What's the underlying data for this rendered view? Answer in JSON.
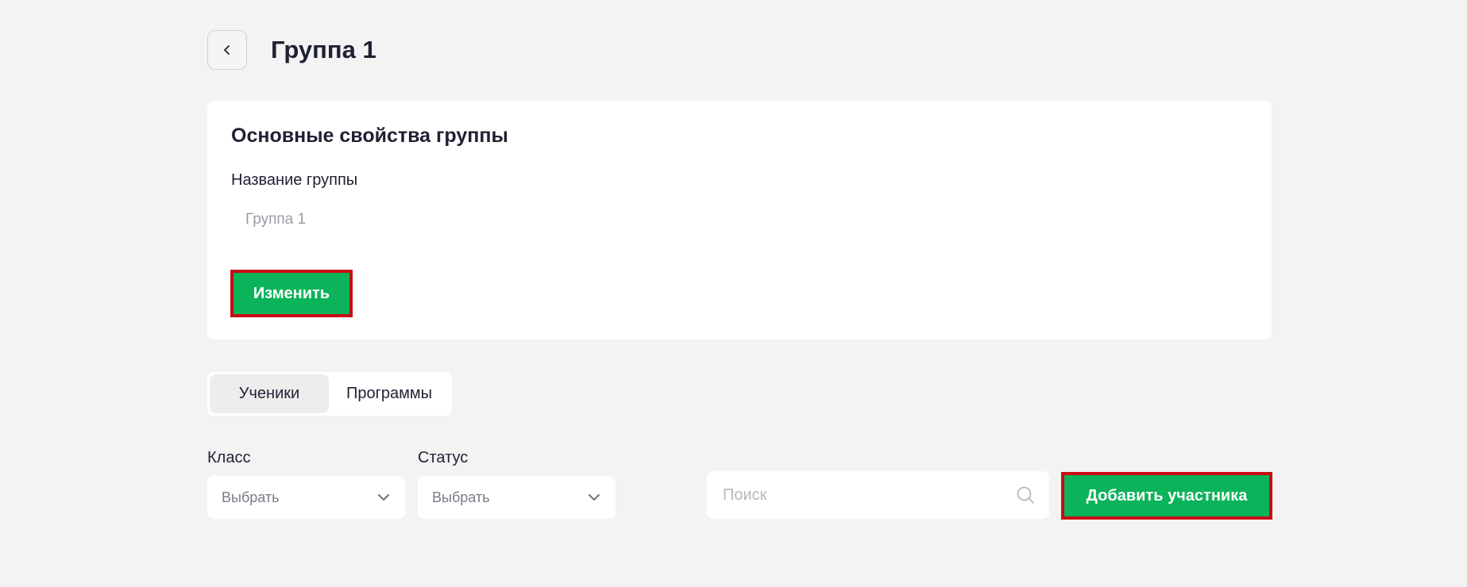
{
  "header": {
    "back_icon": "chevron-left-icon",
    "title": "Группа 1"
  },
  "properties_card": {
    "title": "Основные свойства группы",
    "name_label": "Название группы",
    "name_value": "Группа 1",
    "edit_button": "Изменить"
  },
  "tabs": [
    {
      "label": "Ученики",
      "active": true
    },
    {
      "label": "Программы",
      "active": false
    }
  ],
  "filters": {
    "class_label": "Класс",
    "class_value": "Выбрать",
    "status_label": "Статус",
    "status_value": "Выбрать",
    "dropdown_icon": "chevron-down-icon"
  },
  "search": {
    "placeholder": "Поиск",
    "icon": "search-icon"
  },
  "add_button": "Добавить участника",
  "colors": {
    "background": "#f3f3f3",
    "card": "#ffffff",
    "primary_green": "#0bb35a",
    "highlight_border": "#c80c13",
    "text": "#1f2133",
    "muted_text": "#7a7c86"
  }
}
